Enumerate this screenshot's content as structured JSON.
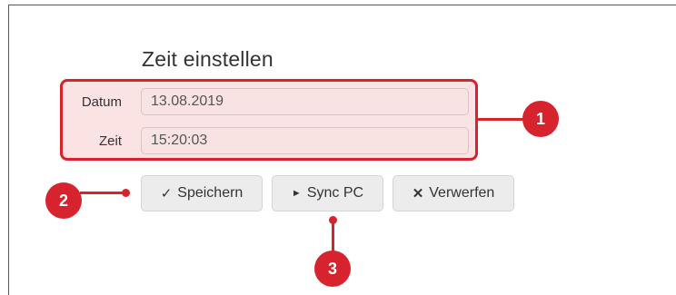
{
  "dialog": {
    "title": "Zeit einstellen",
    "fields": [
      {
        "label": "Datum",
        "value": "13.08.2019"
      },
      {
        "label": "Zeit",
        "value": "15:20:03"
      }
    ]
  },
  "buttons": {
    "save": {
      "icon": "✓",
      "label": "Speichern"
    },
    "sync": {
      "icon": "►",
      "label": "Sync PC"
    },
    "discard": {
      "icon": "✕",
      "label": "Verwerfen"
    }
  },
  "callouts": [
    "1",
    "2",
    "3"
  ],
  "colors": {
    "accent": "#d6232d",
    "highlight_fill": "#fbe3e3",
    "button_bg": "#ececec"
  }
}
